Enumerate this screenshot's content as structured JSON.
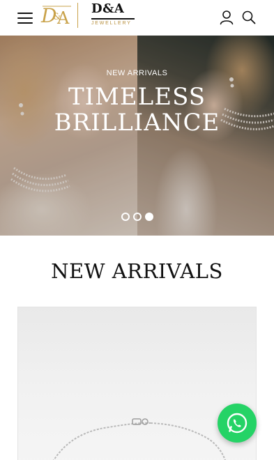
{
  "header": {
    "menu_icon": "hamburger-menu-icon",
    "logo_monogram": "D&A",
    "brand_name": "D&A",
    "brand_subtitle": "JEWELLERY",
    "account_icon": "user-icon",
    "search_icon": "search-icon"
  },
  "colors": {
    "brand_gold": "#c9a24a",
    "whatsapp_green": "#25d366"
  },
  "hero": {
    "kicker": "NEW ARRIVALS",
    "title_line1": "TIMELESS",
    "title_line2": "BRILLIANCE",
    "slide_count": 3,
    "active_slide": 3
  },
  "section": {
    "title": "NEW ARRIVALS"
  },
  "product": {
    "image_icon": "silver-chain-bracelet-image"
  },
  "floating": {
    "whatsapp_icon": "whatsapp-icon"
  }
}
